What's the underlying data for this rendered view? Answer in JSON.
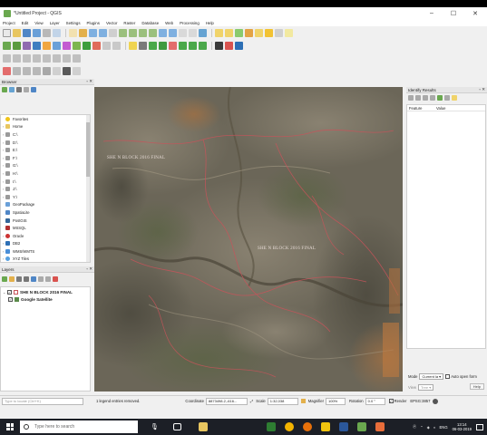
{
  "window": {
    "title": "*Untitled Project - QGIS",
    "controls": {
      "minimize": "–",
      "maximize": "☐",
      "close": "✕"
    }
  },
  "menubar": [
    "Project",
    "Edit",
    "View",
    "Layer",
    "Settings",
    "Plugins",
    "Vector",
    "Raster",
    "Database",
    "Web",
    "Processing",
    "Help"
  ],
  "browser": {
    "title": "Browser",
    "items": [
      {
        "label": "Favorites",
        "icon": "star-icon",
        "expand": ""
      },
      {
        "label": "Home",
        "icon": "folder-icon",
        "expand": "›"
      },
      {
        "label": "C:\\",
        "icon": "drive-icon",
        "expand": "›"
      },
      {
        "label": "D:\\",
        "icon": "drive-icon",
        "expand": "›"
      },
      {
        "label": "E:\\",
        "icon": "drive-icon",
        "expand": "›"
      },
      {
        "label": "F:\\",
        "icon": "drive-icon",
        "expand": "›"
      },
      {
        "label": "G:\\",
        "icon": "drive-icon",
        "expand": "›"
      },
      {
        "label": "H:\\",
        "icon": "drive-icon",
        "expand": "›"
      },
      {
        "label": "I:\\",
        "icon": "drive-icon",
        "expand": "›"
      },
      {
        "label": "J:\\",
        "icon": "drive-icon",
        "expand": "›"
      },
      {
        "label": "Y:\\",
        "icon": "drive-icon",
        "expand": "›"
      },
      {
        "label": "GeoPackage",
        "icon": "geopackage-icon",
        "expand": ""
      },
      {
        "label": "SpatiaLite",
        "icon": "spatialite-icon",
        "expand": ""
      },
      {
        "label": "PostGIS",
        "icon": "postgis-icon",
        "expand": ""
      },
      {
        "label": "MSSQL",
        "icon": "mssql-icon",
        "expand": ""
      },
      {
        "label": "Oracle",
        "icon": "oracle-icon",
        "expand": "›"
      },
      {
        "label": "DB2",
        "icon": "db2-icon",
        "expand": "›"
      },
      {
        "label": "WMS/WMTS",
        "icon": "wms-icon",
        "expand": "›"
      },
      {
        "label": "XYZ Tiles",
        "icon": "xyz-icon",
        "expand": "›"
      }
    ]
  },
  "layers": {
    "title": "Layers",
    "items": [
      {
        "label": "SHE N BLOCK 2016 FINAL",
        "checked": "✓",
        "icon": "polygon-layer-icon"
      },
      {
        "label": "Google Satellite",
        "checked": "✓",
        "icon": "raster-layer-icon"
      }
    ]
  },
  "map": {
    "labels": [
      "SHE N BLOCK 2016 FINAL",
      "SHE N BLOCK 2016 FINAL"
    ]
  },
  "identify": {
    "title": "Identify Results",
    "columns": [
      "Feature",
      "Value"
    ],
    "mode_label": "Mode",
    "mode_value": "Current la",
    "auto_open_label": "Auto open form",
    "view_label": "View",
    "view_value": "Tree",
    "help_label": "Help"
  },
  "statusbar": {
    "locate_placeholder": "Type to locate (Ctrl+K)",
    "message": "1 legend entries removed.",
    "coordinate_label": "Coordinate",
    "coordinate_value": "8873498.2,-616...",
    "scale_label": "Scale",
    "scale_value": "1:32,038",
    "magnifier_label": "Magnifier",
    "magnifier_value": "100%",
    "rotation_label": "Rotation",
    "rotation_value": "0.0 °",
    "render_label": "Render",
    "crs_label": "EPSG:3857"
  },
  "taskbar": {
    "search_placeholder": "Type here to search",
    "language": "ENG",
    "time": "13:14",
    "date": "06-03-2019"
  },
  "colors": {
    "accent": "#6aa84f",
    "boundary": "#c8545a",
    "taskbar": "#1c1f26"
  }
}
